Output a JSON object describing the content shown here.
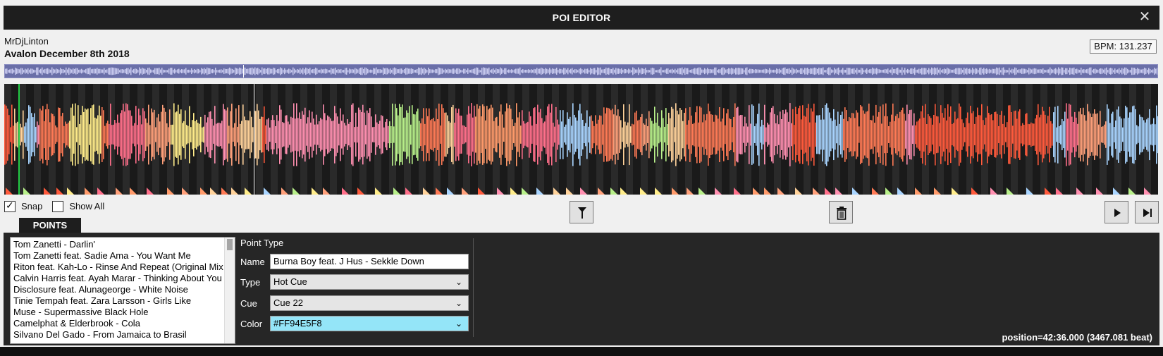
{
  "window": {
    "title": "POI EDITOR",
    "close_icon": "close-icon"
  },
  "mix": {
    "artist": "MrDjLinton",
    "title": "Avalon December 8th 2018",
    "bpm_text": "BPM: 131.237"
  },
  "controls": {
    "snap_label": "Snap",
    "snap_checked": true,
    "show_all_label": "Show All",
    "show_all_checked": false,
    "marker_icon": "marker-pin-icon",
    "delete_icon": "trash-icon",
    "play_icon": "play-icon",
    "skip_icon": "skip-end-icon"
  },
  "tabs": {
    "points_label": "POINTS"
  },
  "tracks": [
    "Tom Zanetti - Darlin'",
    "Tom Zanetti feat. Sadie Ama - You Want Me",
    "Riton feat. Kah-Lo - Rinse And Repeat (Original Mix",
    "Calvin Harris feat. Ayah Marar - Thinking About You",
    "Disclosure feat. Alunageorge - White Noise",
    "Tinie Tempah feat. Zara Larsson - Girls Like",
    "Muse - Supermassive Black Hole",
    "Camelphat & Elderbrook - Cola",
    "Silvano Del Gado - From Jamaica to Brasil"
  ],
  "form": {
    "header": "Point Type",
    "name_label": "Name",
    "name_value": "Burna Boy feat. J Hus - Sekkle Down",
    "type_label": "Type",
    "type_value": "Hot Cue",
    "cue_label": "Cue",
    "cue_value": "Cue 22",
    "color_label": "Color",
    "color_value": "#FF94E5F8"
  },
  "status": {
    "position": "position=42:36.000 (3467.081 beat)"
  },
  "colors": {
    "waveform_palette": [
      "#ff5a3c",
      "#ff7a55",
      "#ff9a6a",
      "#ff6f8a",
      "#ffa07a",
      "#ffd29a",
      "#ffec8a",
      "#b8f08a",
      "#a8d4ff",
      "#ff8fb0"
    ],
    "selected_color": "#94e5f8",
    "playhead": "#22cc44",
    "overview": "#6a6fa8"
  }
}
